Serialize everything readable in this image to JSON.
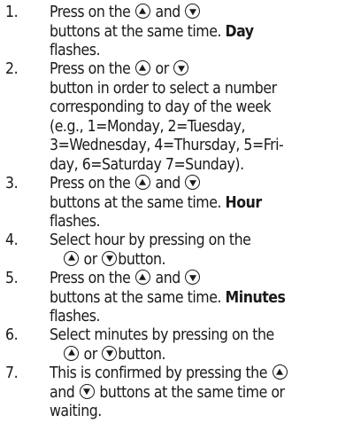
{
  "steps": [
    {
      "number": "1.",
      "lines": [
        {
          "parts": [
            "Press on the ",
            "{up}",
            " and ",
            "{down}"
          ]
        },
        {
          "parts": [
            "buttons at the same time. ",
            "**Day"
          ]
        },
        {
          "parts": [
            "flashes."
          ]
        }
      ]
    },
    {
      "number": "2.",
      "lines": [
        {
          "parts": [
            "Press on the ",
            "{up}",
            " or ",
            "{down}"
          ]
        },
        {
          "parts": [
            "button in order to select a number"
          ]
        },
        {
          "parts": [
            "corresponding to day of the week"
          ]
        },
        {
          "parts": [
            "(e.g., 1=Monday, 2=Tuesday,"
          ]
        },
        {
          "parts": [
            "3=Wednesday, 4=Thursday, 5=Fri-"
          ]
        },
        {
          "parts": [
            "day, 6=Saturday 7=Sunday)."
          ]
        }
      ]
    },
    {
      "number": "3.",
      "lines": [
        {
          "parts": [
            "Press on the ",
            "{up}",
            " and ",
            "{down}"
          ]
        },
        {
          "parts": [
            "buttons at the same time. ",
            "**Hour"
          ]
        },
        {
          "parts": [
            "flashes."
          ]
        }
      ]
    },
    {
      "number": "4.",
      "lines": [
        {
          "parts": [
            "Select hour by pressing on the"
          ]
        },
        {
          "parts": [
            "{up}",
            " or ",
            "{down}",
            "button."
          ],
          "indent": true
        }
      ]
    },
    {
      "number": "5.",
      "lines": [
        {
          "parts": [
            "Press on the ",
            "{up}",
            " and ",
            "{down}"
          ]
        },
        {
          "parts": [
            "buttons at the same time. ",
            "**Minutes"
          ]
        },
        {
          "parts": [
            "flashes."
          ]
        }
      ]
    },
    {
      "number": "6.",
      "lines": [
        {
          "parts": [
            "Select minutes by pressing on the"
          ]
        },
        {
          "parts": [
            "{up}",
            " or ",
            "{down}",
            "button."
          ],
          "indent": true
        }
      ]
    },
    {
      "number": "7.",
      "lines": [
        {
          "parts": [
            "This is confirmed by pressing the ",
            "{up}"
          ]
        },
        {
          "parts": [
            "and ",
            "{down}",
            " buttons at the same time or"
          ]
        },
        {
          "parts": [
            "waiting."
          ]
        }
      ]
    }
  ],
  "icons": {
    "up": "up-arrow-button-icon",
    "down": "down-arrow-button-icon"
  }
}
